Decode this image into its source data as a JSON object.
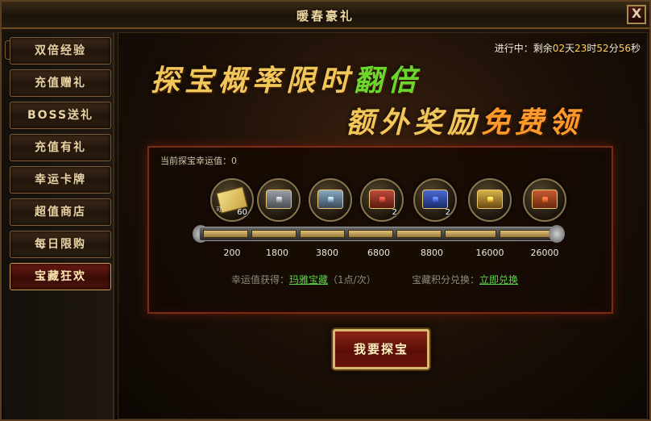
{
  "window": {
    "title": "暖春豪礼",
    "close": "X"
  },
  "sidebar": {
    "items": [
      {
        "label": "双倍经验"
      },
      {
        "label": "充值赠礼"
      },
      {
        "label": "BOSS送礼"
      },
      {
        "label": "充值有礼"
      },
      {
        "label": "幸运卡牌"
      },
      {
        "label": "超值商店"
      },
      {
        "label": "每日限购"
      },
      {
        "label": "宝藏狂欢",
        "active": true
      }
    ]
  },
  "timer": {
    "prefix": "进行中：剩余",
    "days": "02",
    "d": "天",
    "hours": "23",
    "h": "时",
    "minutes": "52",
    "m": "分",
    "seconds": "56",
    "s": "秒"
  },
  "banner": {
    "line1": "探宝概率限时",
    "line1_highlight": "翻倍",
    "line2": "额外奖励",
    "line2_highlight": "免费领"
  },
  "lottery": {
    "luck_label": "当前探宝幸运值：0",
    "rewards": [
      {
        "icon": "scroll-icon",
        "count": "60",
        "tag": "可"
      },
      {
        "icon": "silver-chest-icon",
        "count": ""
      },
      {
        "icon": "silver-chest-icon",
        "count": ""
      },
      {
        "icon": "red-chest-icon",
        "count": "2"
      },
      {
        "icon": "blue-chest-icon",
        "count": "2"
      },
      {
        "icon": "gold-chest-icon",
        "count": ""
      },
      {
        "icon": "red-gold-chest-icon",
        "count": ""
      }
    ],
    "thresholds": [
      "200",
      "1800",
      "3800",
      "6800",
      "8800",
      "16000",
      "26000"
    ],
    "luck_gain_label": "幸运值获得：",
    "luck_gain_link": "玛雅宝藏",
    "luck_gain_note": "（1点/次）",
    "exchange_label": "宝藏积分兑换：",
    "exchange_link": "立即兑换",
    "progress_fraction": 0
  },
  "actions": {
    "start": "我要探宝"
  },
  "colors": {
    "accent_gold": "#f1c75a",
    "highlight_green": "#6bd62e",
    "highlight_orange": "#ff9a2a",
    "link_green": "#5ed24a"
  }
}
